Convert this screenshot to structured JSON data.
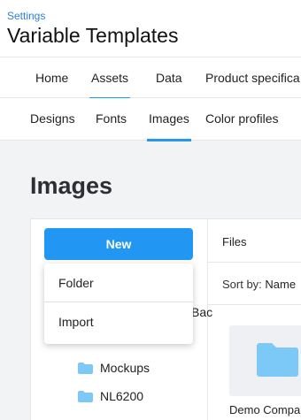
{
  "header": {
    "breadcrumb": "Settings",
    "title": "Variable Templates"
  },
  "nav_primary": {
    "tabs": [
      {
        "label": "Home",
        "active": false
      },
      {
        "label": "Assets",
        "active": true
      },
      {
        "label": "Data",
        "active": false
      },
      {
        "label": "Product specifica",
        "active": false
      }
    ]
  },
  "nav_secondary": {
    "tabs": [
      {
        "label": "Designs",
        "active": false
      },
      {
        "label": "Fonts",
        "active": false
      },
      {
        "label": "Images",
        "active": true
      },
      {
        "label": "Color profiles",
        "active": false
      }
    ]
  },
  "main": {
    "section_title": "Images",
    "new_button": "New",
    "files_label": "Files",
    "sort_prefix": "Sort by:",
    "sort_value": "Name",
    "card_label": "Demo Compa",
    "partial_text": "Bac"
  },
  "dropdown": {
    "items": [
      "Folder",
      "Import"
    ]
  },
  "tree": {
    "items": [
      "Mockups",
      "NL6200"
    ]
  },
  "colors": {
    "accent": "#2196f3",
    "folder": "#7cc8f7",
    "link": "#2f7fd6"
  }
}
